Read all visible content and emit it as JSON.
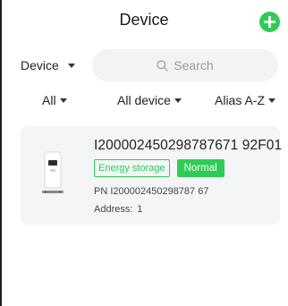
{
  "header": {
    "title": "Device"
  },
  "search": {
    "scope_label": "Device",
    "placeholder": "Search"
  },
  "filters": {
    "status": "All",
    "type": "All device",
    "sort": "Alias A-Z"
  },
  "devices": [
    {
      "sn": "I200002450298787671 92F01",
      "category_tag": "Energy storage",
      "status_tag": "Normal",
      "pn": "PN  I200002450298787 67",
      "address_label": "Address:",
      "address_value": "1"
    }
  ],
  "colors": {
    "accent": "#2ecc55",
    "card_bg": "#f4f5f7",
    "search_bg": "#f2f3f5"
  },
  "icons": {
    "add": "plus-circle-icon",
    "search": "magnifier-icon",
    "dropdown": "caret-down-icon"
  }
}
